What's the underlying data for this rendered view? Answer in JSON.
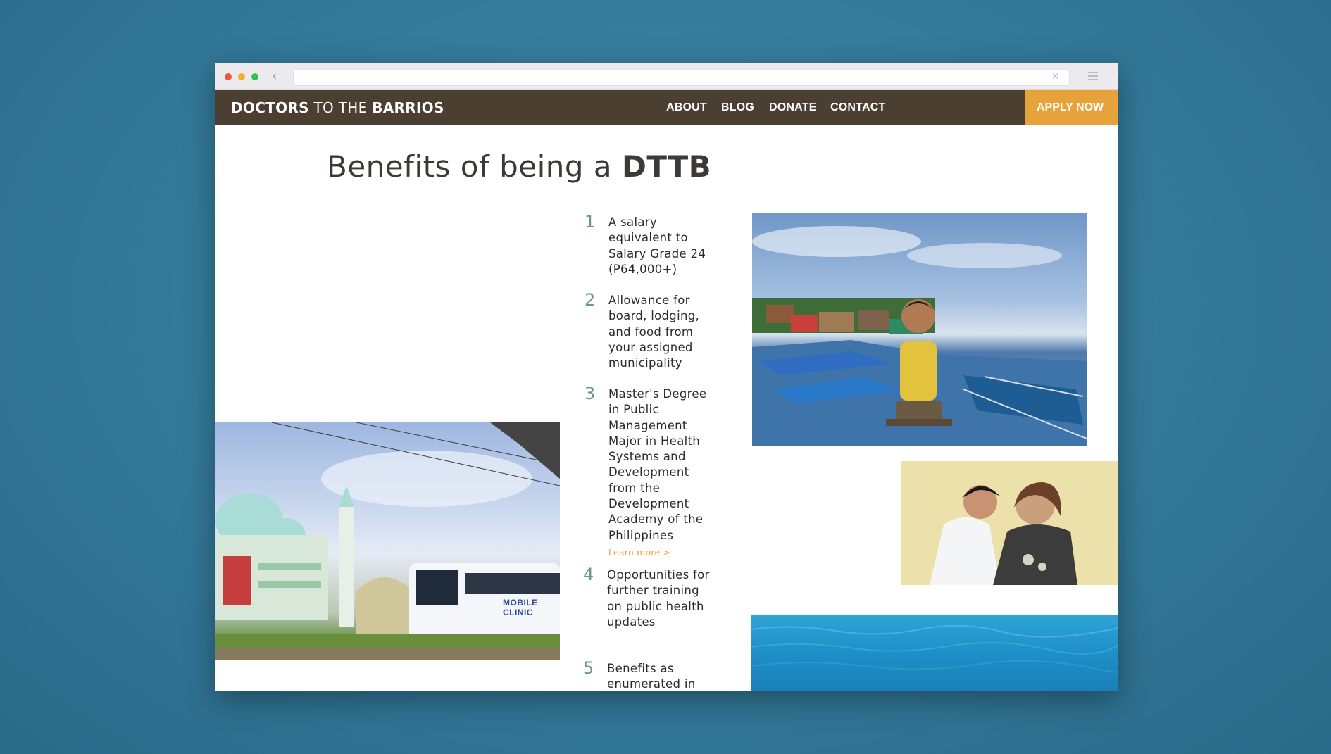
{
  "browser": {
    "back_glyph": "‹",
    "url": "",
    "url_close_glyph": "×"
  },
  "nav": {
    "brand": {
      "part1": "DOCTORS",
      "part2": "TO THE",
      "part3": "BARRIOS"
    },
    "links": [
      "ABOUT",
      "BLOG",
      "DONATE",
      "CONTACT"
    ],
    "cta": "APPLY NOW"
  },
  "page": {
    "heading_prefix": "Benefits of being a ",
    "heading_bold": "DTTB"
  },
  "benefits": [
    {
      "num": "1",
      "text": "A salary equivalent to Salary Grade 24 (P64,000+)"
    },
    {
      "num": "2",
      "text": "Allowance for board, lodging, and food from your assigned municipality"
    },
    {
      "num": "3",
      "text": "Master's Degree in Public Management Major in Health Systems and Development from the Development Academy of the Philippines",
      "link": "Learn more >"
    },
    {
      "num": "4",
      "text": "Opportunities for further training on public health updates"
    },
    {
      "num": "5",
      "text": "Benefits as enumerated in"
    }
  ],
  "images": {
    "mosque_bus_label": "MOBILE CLINIC"
  },
  "colors": {
    "background": "#357b9b",
    "nav_bg": "#4b3f32",
    "cta_bg": "#e7a33b",
    "number_green": "#6b9a7e",
    "link_orange": "#e7a33b"
  }
}
